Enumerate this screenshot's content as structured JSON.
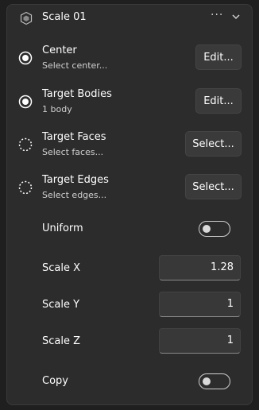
{
  "header": {
    "title": "Scale 01",
    "more_label": "···"
  },
  "center": {
    "label": "Center",
    "sublabel": "Select center...",
    "button": "Edit..."
  },
  "target_bodies": {
    "label": "Target Bodies",
    "sublabel": "1 body",
    "button": "Edit..."
  },
  "target_faces": {
    "label": "Target Faces",
    "sublabel": "Select faces...",
    "button": "Select..."
  },
  "target_edges": {
    "label": "Target Edges",
    "sublabel": "Select edges...",
    "button": "Select..."
  },
  "uniform": {
    "label": "Uniform",
    "on": false
  },
  "scale_x": {
    "label": "Scale X",
    "value": "1.28"
  },
  "scale_y": {
    "label": "Scale Y",
    "value": "1"
  },
  "scale_z": {
    "label": "Scale Z",
    "value": "1"
  },
  "copy": {
    "label": "Copy",
    "on": false
  }
}
